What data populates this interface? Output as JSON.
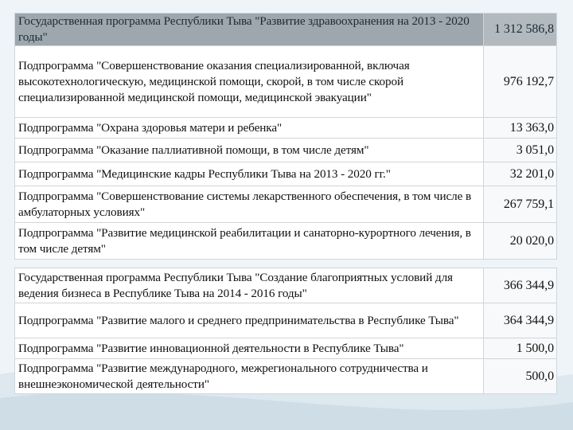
{
  "rows": [
    {
      "label": "Государственная программа Республики Тыва \"Развитие здравоохранения на 2013 - 2020 годы\"",
      "value": "1 312 586,8",
      "kind": "head"
    },
    {
      "label": "Подпрограмма \"Совершенствование оказания специализированной, включая высокотехнологическую, медицинской помощи, скорой, в том числе скорой специализированной медицинской помощи, медицинской эвакуации\"",
      "value": "976 192,7",
      "kind": "sub"
    },
    {
      "label": "Подпрограмма \"Охрана здоровья матери и ребенка\"",
      "value": "13 363,0",
      "kind": "sub"
    },
    {
      "label": "Подпрограмма \"Оказание паллиативной помощи, в том числе детям\"",
      "value": "3 051,0",
      "kind": "sub"
    },
    {
      "label": "Подпрограмма \"Медицинские кадры Республики Тыва на 2013 - 2020 гг.\"",
      "value": "32 201,0",
      "kind": "sub"
    },
    {
      "label": "Подпрограмма \"Совершенствование системы лекарственного обеспечения, в том числе в амбулаторных условиях\"",
      "value": "267 759,1",
      "kind": "sub"
    },
    {
      "label": "Подпрограмма \"Развитие медицинской реабилитации и санаторно-курортного лечения, в том числе детям\"",
      "value": "20 020,0",
      "kind": "sub"
    },
    {
      "label": "Государственная программа Республики Тыва \"Создание благоприятных условий для ведения бизнеса в Республике Тыва на 2014 - 2016 годы\"",
      "value": "366 344,9",
      "kind": "sub"
    },
    {
      "label": "Подпрограмма \"Развитие малого и среднего предпринимательства в Республике Тыва\"",
      "value": "364 344,9",
      "kind": "sub"
    },
    {
      "label": "Подпрограмма \"Развитие инновационной деятельности в Республике Тыва\"",
      "value": "1 500,0",
      "kind": "sub"
    },
    {
      "label": "Подпрограмма \"Развитие международного, межрегионального сотрудничества и внешнеэкономической деятельности\"",
      "value": "500,0",
      "kind": "sub"
    }
  ]
}
